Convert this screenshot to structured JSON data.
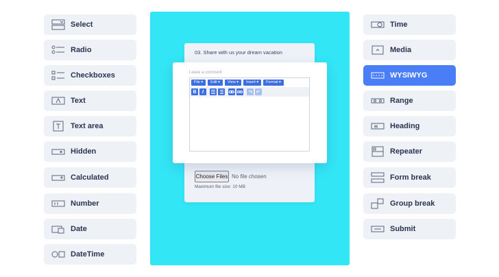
{
  "left_fields": [
    {
      "label": "Select",
      "icon": "select-icon"
    },
    {
      "label": "Radio",
      "icon": "radio-icon"
    },
    {
      "label": "Checkboxes",
      "icon": "checkboxes-icon"
    },
    {
      "label": "Text",
      "icon": "text-icon"
    },
    {
      "label": "Text area",
      "icon": "textarea-icon"
    },
    {
      "label": "Hidden",
      "icon": "hidden-icon"
    },
    {
      "label": "Calculated",
      "icon": "calculated-icon"
    },
    {
      "label": "Number",
      "icon": "number-icon"
    },
    {
      "label": "Date",
      "icon": "date-icon"
    },
    {
      "label": "DateTime",
      "icon": "datetime-icon"
    }
  ],
  "right_fields": [
    {
      "label": "Time",
      "icon": "time-icon"
    },
    {
      "label": "Media",
      "icon": "media-icon"
    },
    {
      "label": "WYSIWYG",
      "icon": "wysiwyg-icon",
      "active": true
    },
    {
      "label": "Range",
      "icon": "range-icon"
    },
    {
      "label": "Heading",
      "icon": "heading-icon"
    },
    {
      "label": "Repeater",
      "icon": "repeater-icon"
    },
    {
      "label": "Form break",
      "icon": "form-break-icon"
    },
    {
      "label": "Group break",
      "icon": "group-break-icon"
    },
    {
      "label": "Submit",
      "icon": "submit-icon"
    }
  ],
  "preview": {
    "question": "03. Share with us your dream vacation",
    "comment_label": "Leave a comment",
    "menus": [
      "File ▾",
      "Edit ▾",
      "View ▾",
      "Insert ▾",
      "Format ▾"
    ],
    "choose_files": "Choose Files",
    "no_file": "No file chosen",
    "max_size": "Maximum file size: 10 MB"
  },
  "toolbar_icons": [
    "bold-icon",
    "italic-icon",
    "bullet-list-icon",
    "numbered-list-icon",
    "link-icon",
    "unlink-icon",
    "undo-icon",
    "redo-icon"
  ],
  "colors": {
    "accent": "#4a7ef7",
    "panel": "#33e6f5",
    "button_bg": "#eef1f6"
  }
}
